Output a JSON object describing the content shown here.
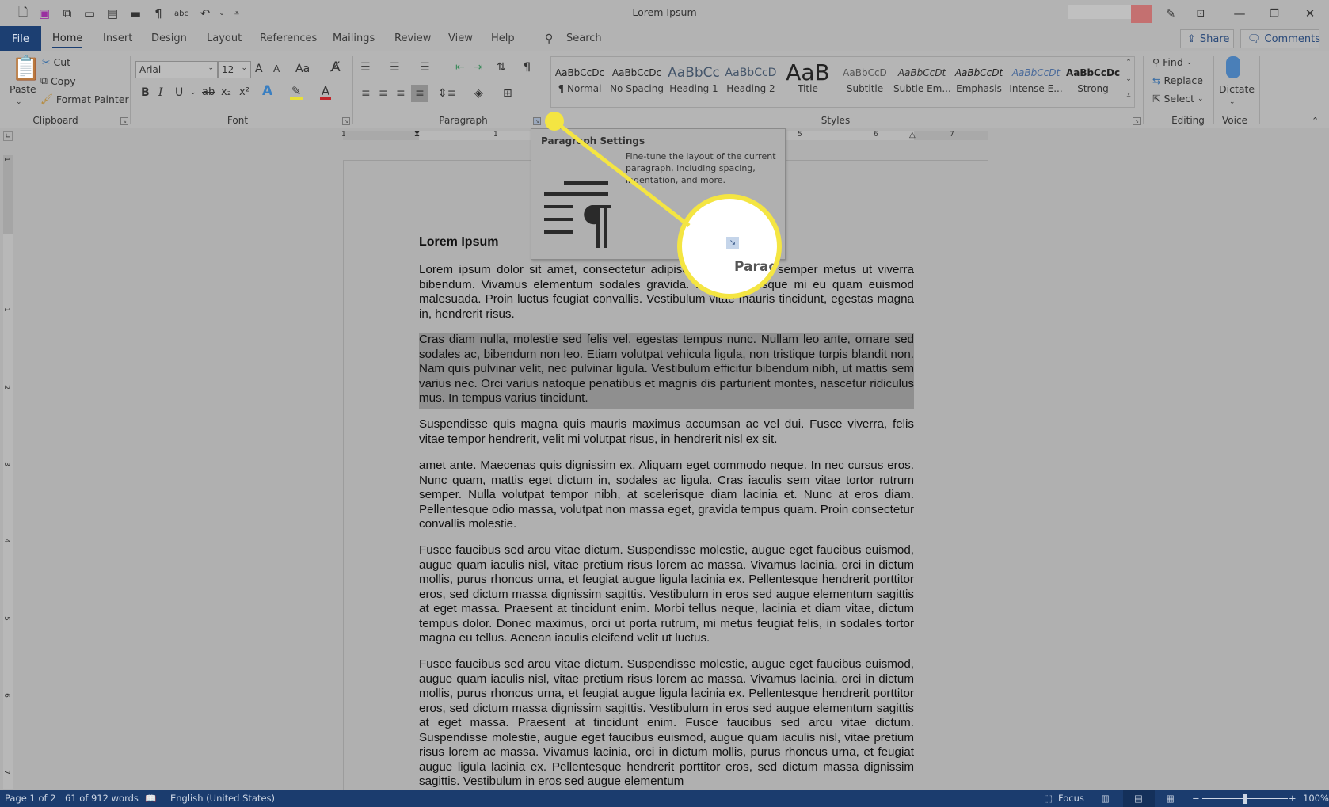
{
  "window": {
    "title": "Lorem Ipsum",
    "controls": {
      "minimize": "—",
      "restore": "❐",
      "close": "✕"
    }
  },
  "quick_access": {
    "icons": [
      "new-document-icon",
      "save-icon",
      "save-as-icon",
      "open-folder-icon",
      "reading-view-icon",
      "print-layout-icon",
      "show-formatting-icon",
      "spelling-icon",
      "undo-icon",
      "customize-qat-icon"
    ],
    "pilcrow": "¶",
    "spelling": "abc"
  },
  "tabs": [
    {
      "label": "File"
    },
    {
      "label": "Home",
      "active": true
    },
    {
      "label": "Insert"
    },
    {
      "label": "Design"
    },
    {
      "label": "Layout"
    },
    {
      "label": "References"
    },
    {
      "label": "Mailings"
    },
    {
      "label": "Review"
    },
    {
      "label": "View"
    },
    {
      "label": "Help"
    }
  ],
  "search": {
    "label": "Search"
  },
  "header_buttons": {
    "share": "Share",
    "comments": "Comments"
  },
  "ribbon": {
    "clipboard": {
      "label": "Clipboard",
      "paste": "Paste",
      "cut": "Cut",
      "copy": "Copy",
      "format_painter": "Format Painter"
    },
    "font": {
      "label": "Font",
      "font_name": "Arial",
      "font_size": "12",
      "grow": "A",
      "shrink": "A",
      "change_case": "Aa",
      "bold": "B",
      "italic": "I",
      "underline": "U",
      "strike": "ab",
      "subscript": "x₂",
      "superscript": "x²",
      "text_effects": "A",
      "font_color": "A",
      "highlight_color": "#e8e03a",
      "font_color_value": "#c0262b"
    },
    "paragraph": {
      "label": "Paragraph",
      "pilcrow": "¶"
    },
    "styles": {
      "label": "Styles",
      "items": [
        {
          "sample": "AaBbCcDc",
          "name": "¶ Normal"
        },
        {
          "sample": "AaBbCcDc",
          "name": "No Spacing"
        },
        {
          "sample": "AaBbCc",
          "name": "Heading 1"
        },
        {
          "sample": "AaBbCcD",
          "name": "Heading 2"
        },
        {
          "sample": "AaB",
          "name": "Title"
        },
        {
          "sample": "AaBbCcD",
          "name": "Subtitle"
        },
        {
          "sample": "AaBbCcDt",
          "name": "Subtle Em..."
        },
        {
          "sample": "AaBbCcDt",
          "name": "Emphasis"
        },
        {
          "sample": "AaBbCcDt",
          "name": "Intense E..."
        },
        {
          "sample": "AaBbCcDc",
          "name": "Strong"
        }
      ]
    },
    "editing": {
      "label": "Editing",
      "find": "Find",
      "replace": "Replace",
      "select": "Select"
    },
    "voice": {
      "label": "Voice",
      "dictate": "Dictate"
    }
  },
  "ruler": {
    "horizontal": [
      "1",
      "1",
      "5",
      "6",
      "7"
    ],
    "vertical": [
      "1",
      "1",
      "2",
      "3",
      "4",
      "5",
      "6",
      "7"
    ]
  },
  "tooltip": {
    "title": "Paragraph Settings",
    "description": "Fine-tune the layout of the current paragraph, including spacing, indentation, and more."
  },
  "magnifier": {
    "label": "Parag"
  },
  "document": {
    "heading": "Lorem Ipsum",
    "paragraphs": [
      {
        "text": "Lorem ipsum dolor sit amet, consectetur adipiscing elit. Nullam semper metus ut viverra bibendum. Vivamus elementum sodales gravida. Nam scelerisque mi eu quam euismod malesuada. Proin luctus feugiat convallis. Vestibulum vitae mauris tincidunt, egestas magna in, hendrerit risus.",
        "selected": false
      },
      {
        "text": "Cras diam nulla, molestie sed felis vel, egestas tempus nunc. Nullam leo ante, ornare sed sodales ac, bibendum non leo. Etiam volutpat vehicula ligula, non tristique turpis blandit non. Nam quis pulvinar velit, nec pulvinar ligula. Vestibulum efficitur bibendum nibh, ut mattis sem varius nec. Orci varius natoque penatibus et magnis dis parturient montes, nascetur ridiculus mus. In tempus varius tincidunt.",
        "selected": true
      },
      {
        "text": "Suspendisse quis magna quis mauris maximus accumsan ac vel dui. Fusce viverra, felis vitae tempor hendrerit, velit mi volutpat risus, in hendrerit nisl ex sit.",
        "selected": false
      },
      {
        "text": "amet ante. Maecenas quis dignissim ex. Aliquam eget commodo neque. In nec cursus eros. Nunc quam, mattis eget dictum in, sodales ac ligula. Cras iaculis sem vitae tortor rutrum semper. Nulla volutpat tempor nibh, at scelerisque diam lacinia et. Nunc at eros diam. Pellentesque odio massa, volutpat non massa eget, gravida tempus quam. Proin consectetur convallis molestie.",
        "selected": false
      },
      {
        "text": "Fusce faucibus sed arcu vitae dictum. Suspendisse molestie, augue eget faucibus euismod, augue quam iaculis nisl, vitae pretium risus lorem ac massa. Vivamus lacinia, orci in dictum mollis, purus rhoncus urna, et feugiat augue ligula lacinia ex. Pellentesque hendrerit porttitor eros, sed dictum massa dignissim sagittis. Vestibulum in eros sed augue elementum sagittis at eget massa. Praesent at tincidunt enim. Morbi tellus neque, lacinia et diam vitae, dictum tempus dolor. Donec maximus, orci ut porta rutrum, mi metus feugiat felis, in sodales tortor magna eu tellus. Aenean iaculis eleifend velit ut luctus.",
        "selected": false
      },
      {
        "text": "Fusce faucibus sed arcu vitae dictum. Suspendisse molestie, augue eget faucibus euismod, augue quam iaculis nisl, vitae pretium risus lorem ac massa. Vivamus lacinia, orci in dictum mollis, purus rhoncus urna, et feugiat augue ligula lacinia ex. Pellentesque hendrerit porttitor eros, sed dictum massa dignissim sagittis. Vestibulum in eros sed augue elementum sagittis at eget massa. Praesent at tincidunt enim. Fusce faucibus sed arcu vitae dictum. Suspendisse molestie, augue eget faucibus euismod, augue quam iaculis nisl, vitae pretium risus lorem ac massa. Vivamus lacinia, orci in dictum mollis, purus rhoncus urna, et feugiat augue ligula lacinia ex. Pellentesque hendrerit porttitor eros, sed dictum massa dignissim sagittis. Vestibulum in eros sed augue elementum",
        "selected": false
      }
    ]
  },
  "statusbar": {
    "page": "Page 1 of 2",
    "words": "61 of 912 words",
    "language": "English (United States)",
    "focus": "Focus",
    "zoom": "100%",
    "zoom_percent": 100
  },
  "colors": {
    "accent": "#1b3c6e",
    "callout": "#f4e542",
    "selection": "#8f8f8f"
  }
}
